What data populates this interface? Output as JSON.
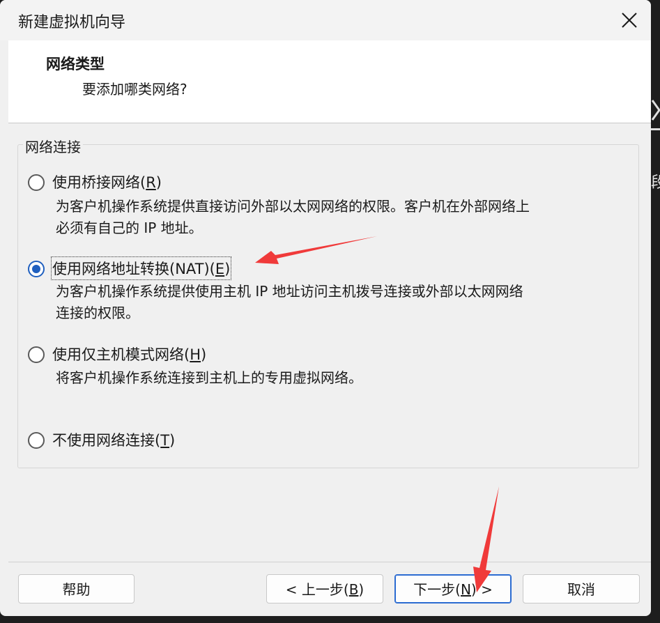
{
  "window": {
    "title": "新建虚拟机向导"
  },
  "header": {
    "title": "网络类型",
    "subtitle": "要添加哪类网络?"
  },
  "group": {
    "legend": "网络连接",
    "options": [
      {
        "label_prefix": "使用桥接网络(",
        "mnemonic": "R",
        "label_suffix": ")",
        "checked": false,
        "desc_lines": [
          "为客户机操作系统提供直接访问外部以太网网络的权限。客户机在外部网络上",
          "必须有自己的 IP 地址。"
        ]
      },
      {
        "label_prefix": "使用网络地址转换(NAT)(",
        "mnemonic": "E",
        "label_suffix": ")",
        "checked": true,
        "desc_lines": [
          "为客户机操作系统提供使用主机 IP 地址访问主机拨号连接或外部以太网网络",
          "连接的权限。"
        ]
      },
      {
        "label_prefix": "使用仅主机模式网络(",
        "mnemonic": "H",
        "label_suffix": ")",
        "checked": false,
        "desc_lines": [
          "将客户机操作系统连接到主机上的专用虚拟网络。"
        ]
      },
      {
        "label_prefix": "不使用网络连接(",
        "mnemonic": "T",
        "label_suffix": ")",
        "checked": false,
        "desc_lines": []
      }
    ]
  },
  "buttons": {
    "help": {
      "label": "帮助"
    },
    "back": {
      "prefix": "< 上一步(",
      "mnemonic": "B",
      "suffix": ")"
    },
    "next": {
      "prefix": "下一步(",
      "mnemonic": "N",
      "suffix": ") >"
    },
    "cancel": {
      "label": "取消"
    }
  },
  "background": {
    "edge_glyph": "段"
  },
  "colors": {
    "accent": "#1f5fbf",
    "annotation_arrow": "#f03a3a"
  }
}
